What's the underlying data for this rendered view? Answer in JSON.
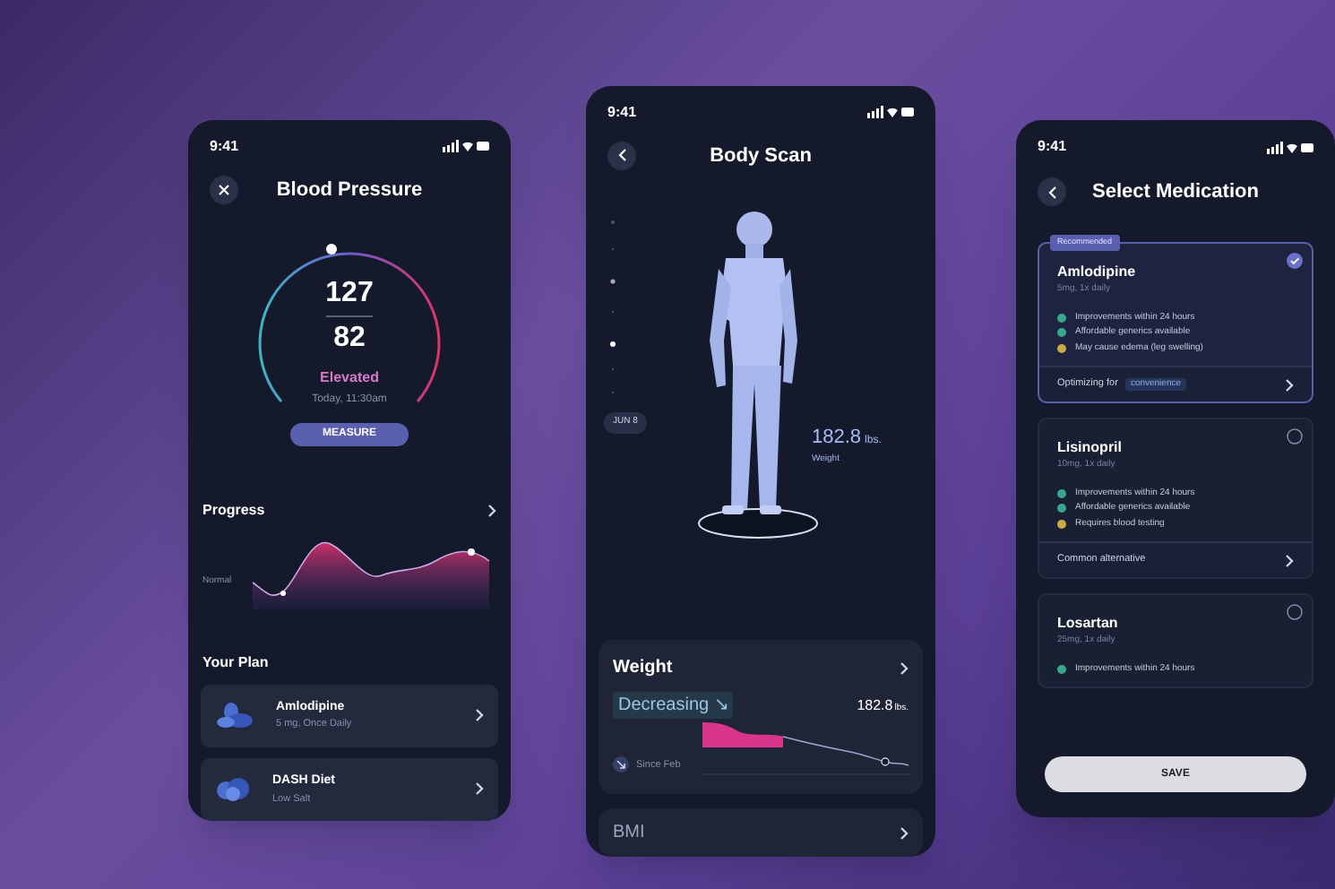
{
  "screens": [
    {
      "kind": "blood_pressure",
      "time": "9:41",
      "title": "Blood Pressure",
      "systolic": "127",
      "diastolic": "82",
      "status": "Elevated",
      "timestamp": "Today, 11:30am",
      "measure_button": "MEASURE",
      "progress": {
        "title": "Progress",
        "baseline_label": "Normal"
      },
      "plan": {
        "title": "Your Plan",
        "items": [
          {
            "name": "Amlodipine",
            "detail": "5 mg, Once Daily"
          },
          {
            "name": "DASH Diet",
            "detail": "Low Salt"
          }
        ]
      }
    },
    {
      "kind": "body_scan",
      "time": "9:41",
      "title": "Body Scan",
      "timeline_label": "JUN 8",
      "scan_value": "182.8",
      "scan_unit": "lbs.",
      "scan_label": "Weight",
      "weight_card": {
        "title": "Weight",
        "trend": "Decreasing",
        "trend_icon": "↘",
        "value": "182.8",
        "unit": "lbs.",
        "since": "Since Feb"
      },
      "next_card": {
        "title": "BMI"
      }
    },
    {
      "kind": "medication",
      "time": "9:41",
      "title": "Select Medication",
      "options": [
        {
          "name": "Amlodipine",
          "dose": "5mg, 1x daily",
          "selected": true,
          "badge": "Recommended",
          "features": [
            {
              "text": "Improvements within 24 hours",
              "kind": "good"
            },
            {
              "text": "Affordable generics available",
              "kind": "good"
            },
            {
              "text": "May cause edema (leg swelling)",
              "kind": "warning"
            }
          ],
          "footer": "Optimizing for",
          "tag": "convenience"
        },
        {
          "name": "Lisinopril",
          "dose": "10mg, 1x daily",
          "selected": false,
          "features": [
            {
              "text": "Improvements within 24 hours",
              "kind": "good"
            },
            {
              "text": "Affordable generics available",
              "kind": "good"
            },
            {
              "text": "Requires blood testing",
              "kind": "warning"
            }
          ],
          "footer": "Common alternative"
        },
        {
          "name": "Losartan",
          "dose": "25mg, 1x daily",
          "selected": false,
          "features": [
            {
              "text": "Improvements within 24 hours",
              "kind": "good"
            }
          ]
        }
      ],
      "save_button": "SAVE"
    }
  ]
}
